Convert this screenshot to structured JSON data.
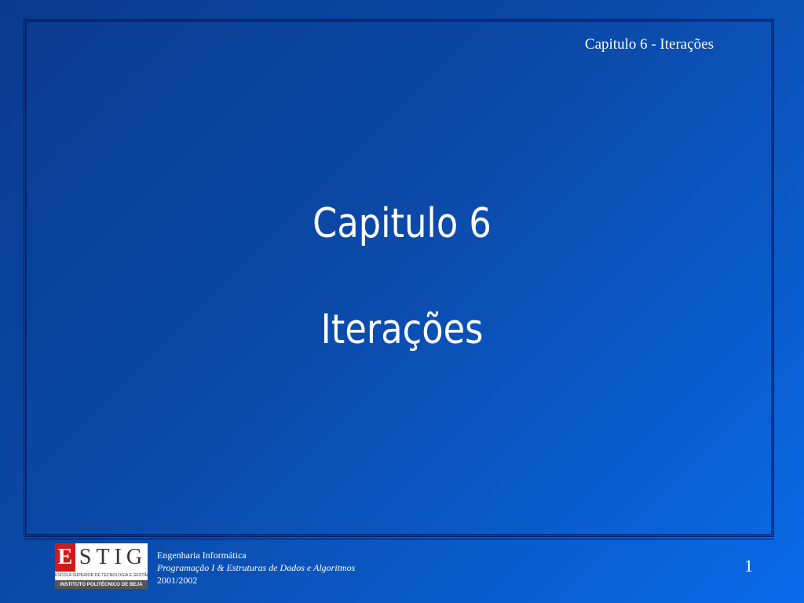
{
  "header": {
    "text": "Capitulo 6 - Iterações"
  },
  "slide": {
    "title": "Capitulo 6",
    "subtitle": "Iterações"
  },
  "logo": {
    "letter_e": "E",
    "letters_rest": "STIG",
    "line1": "ESCOLA SUPERIOR DE TECNOLOGIA E GESTÃO",
    "line2": "INSTITUTO POLITÉCNICO DE BEJA",
    "accent_color": "#d21a1a"
  },
  "footer": {
    "line1": "Engenharia Informática",
    "line2": "Programação I & Estruturas de Dados e Algoritmos",
    "line3": "2001/2002"
  },
  "page": {
    "number": "1"
  },
  "colors": {
    "background_start": "#0a3a8c",
    "background_end": "#0a6ae8",
    "text": "#ffffff"
  }
}
